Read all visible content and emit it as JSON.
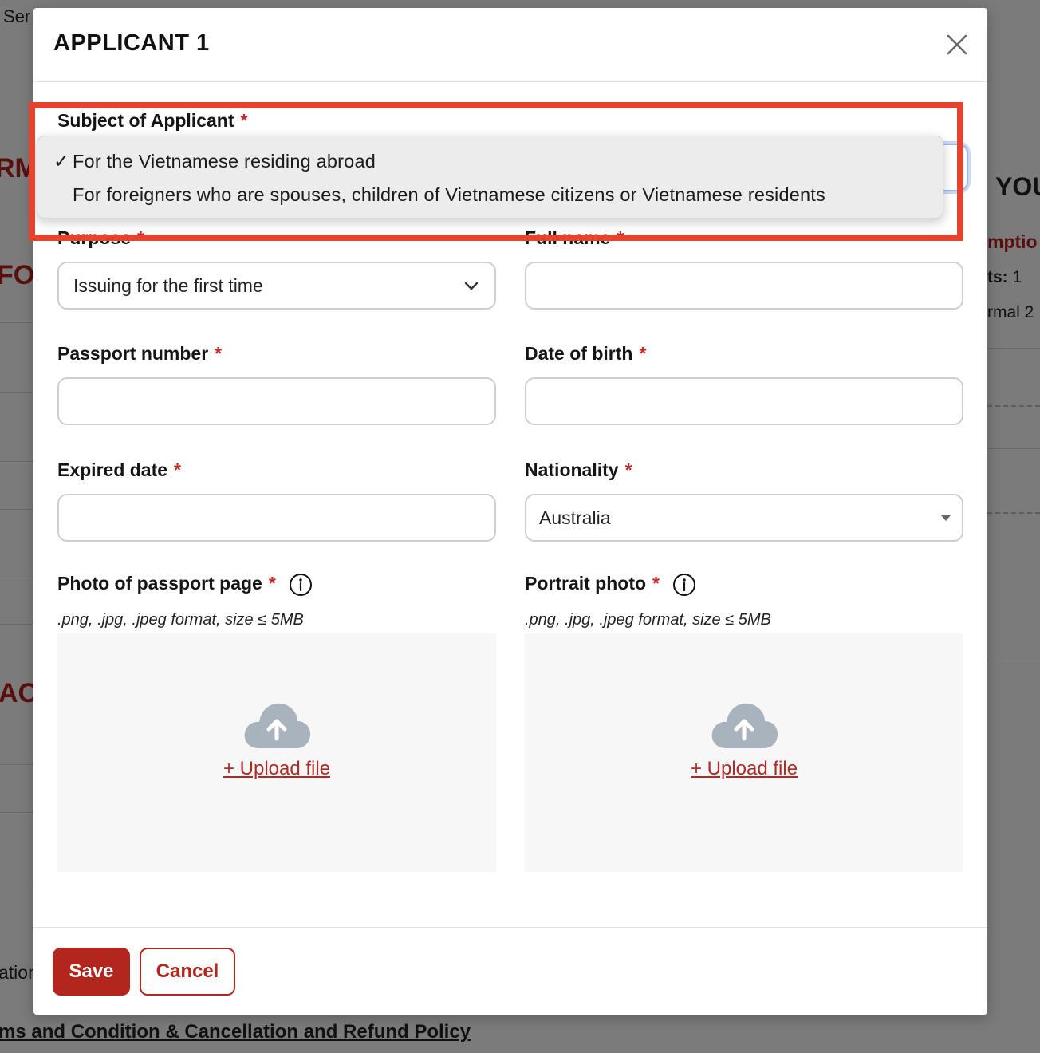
{
  "background": {
    "top_left_text": "Ser",
    "left_fragments": [
      "RM",
      "FO",
      "AC",
      "ation"
    ],
    "right_heading": "YOU",
    "right_red": "mptio",
    "right_count_label": "ts:",
    "right_count_value": "1",
    "right_normal": "rmal 2",
    "bottom_link": "ms and Condition & Cancellation and Refund Policy"
  },
  "modal": {
    "title": "APPLICANT 1",
    "fields": {
      "subject": {
        "label": "Subject of Applicant",
        "required": "*"
      },
      "purpose": {
        "label": "Purpose",
        "required": "*",
        "value": "Issuing for the first time"
      },
      "full_name": {
        "label": "Full name",
        "required": "*",
        "value": ""
      },
      "passport_number": {
        "label": "Passport number",
        "required": "*",
        "value": ""
      },
      "date_of_birth": {
        "label": "Date of birth",
        "required": "*",
        "value": ""
      },
      "expired_date": {
        "label": "Expired date",
        "required": "*",
        "value": ""
      },
      "nationality": {
        "label": "Nationality",
        "required": "*",
        "value": "Australia"
      },
      "passport_photo": {
        "label": "Photo of passport page",
        "required": "*",
        "hint": ".png, .jpg, .jpeg format, size ≤ 5MB",
        "upload_label": "+ Upload file"
      },
      "portrait_photo": {
        "label": "Portrait photo",
        "required": "*",
        "hint": ".png, .jpg, .jpeg format, size ≤ 5MB",
        "upload_label": "+ Upload file"
      }
    },
    "buttons": {
      "save": "Save",
      "cancel": "Cancel"
    }
  },
  "dropdown": {
    "check": "✓",
    "options": [
      {
        "label": "For the Vietnamese residing abroad",
        "selected": true
      },
      {
        "label": "For foreigners who are spouses, children of Vietnamese citizens or Vietnamese residents",
        "selected": false
      }
    ]
  },
  "colors": {
    "accent": "#b3261e",
    "highlight": "#e5432d",
    "overlay": "#7b7b7b"
  },
  "icons": [
    "close-icon",
    "chevron-down-icon",
    "caret-down-icon",
    "info-icon",
    "cloud-upload-icon",
    "check-icon"
  ]
}
